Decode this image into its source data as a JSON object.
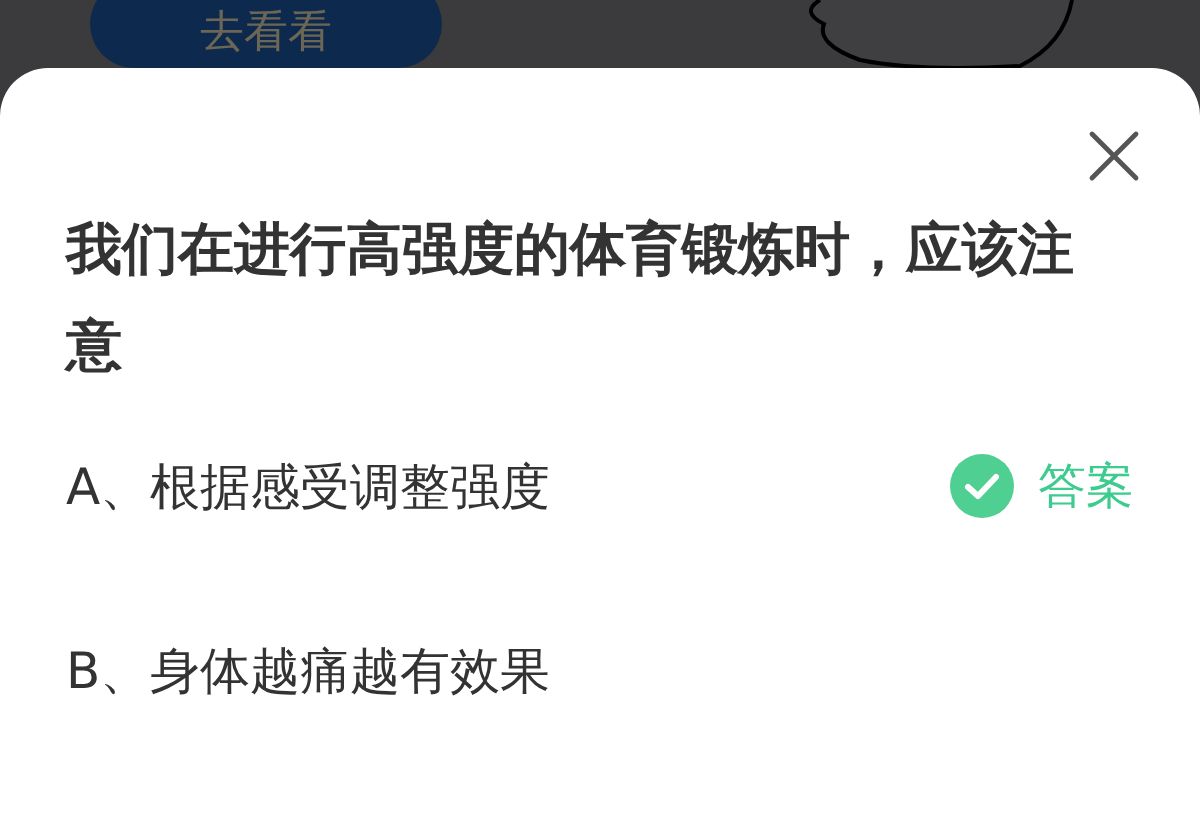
{
  "background": {
    "button": "去看看"
  },
  "question": "我们在进行高强度的体育锻炼时，应该注意",
  "answer_label": "答案",
  "options": [
    {
      "label": "A、根据感受调整强度",
      "correct": true
    },
    {
      "label": "B、身体越痛越有效果",
      "correct": false
    }
  ]
}
